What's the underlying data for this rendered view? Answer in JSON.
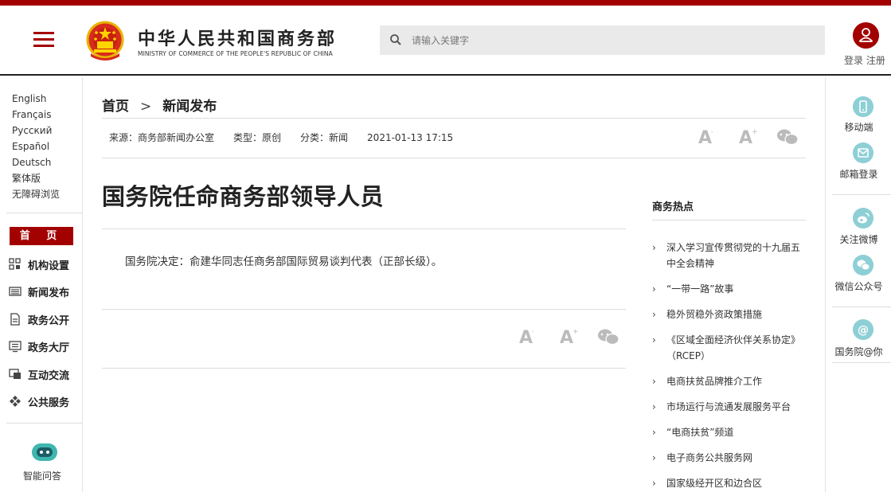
{
  "header": {
    "logo_cn": "中华人民共和国商务部",
    "logo_en": "MINISTRY OF COMMERCE OF THE PEOPLE'S REPUBLIC OF CHINA",
    "search_placeholder": "请输入关键字",
    "login_text": "登录 注册",
    "brand_color": "#a30000"
  },
  "languages": [
    "English",
    "Français",
    "Русский",
    "Español",
    "Deutsch",
    "繁体版",
    "无障碍浏览"
  ],
  "left_nav": {
    "home": "首  页",
    "items": [
      {
        "label": "机构设置",
        "icon": "grid-icon"
      },
      {
        "label": "新闻发布",
        "icon": "news-icon"
      },
      {
        "label": "政务公开",
        "icon": "document-icon"
      },
      {
        "label": "政务大厅",
        "icon": "monitor-icon"
      },
      {
        "label": "互动交流",
        "icon": "chat-icon"
      },
      {
        "label": "公共服务",
        "icon": "service-icon"
      }
    ],
    "assistant": "智能问答"
  },
  "breadcrumb": {
    "home": "首页",
    "separator": ">",
    "current": "新闻发布"
  },
  "meta": {
    "source": "来源：商务部新闻办公室",
    "type": "类型：原创",
    "category": "分类：新闻",
    "datetime": "2021-01-13 17:15"
  },
  "article": {
    "title": "国务院任命商务部领导人员",
    "body": "国务院决定：俞建华同志任商务部国际贸易谈判代表（正部长级）。"
  },
  "hot": {
    "title": "商务热点",
    "items": [
      "深入学习宣传贯彻党的十九届五中全会精神",
      "“一带一路”故事",
      "稳外贸稳外资政策措施",
      "《区域全面经济伙伴关系协定》（RCEP）",
      "电商扶贫品牌推介工作",
      "市场运行与流通发展服务平台",
      "“电商扶贫”频道",
      "电子商务公共服务网",
      "国家级经开区和边合区"
    ]
  },
  "right_nav": {
    "items": [
      {
        "label": "移动端",
        "icon": "mobile-icon"
      },
      {
        "label": "邮箱登录",
        "icon": "mail-icon"
      },
      {
        "label": "关注微博",
        "icon": "weibo-icon"
      },
      {
        "label": "微信公众号",
        "icon": "wechat-icon"
      },
      {
        "label": "国务院@你",
        "icon": "at-icon"
      }
    ]
  }
}
